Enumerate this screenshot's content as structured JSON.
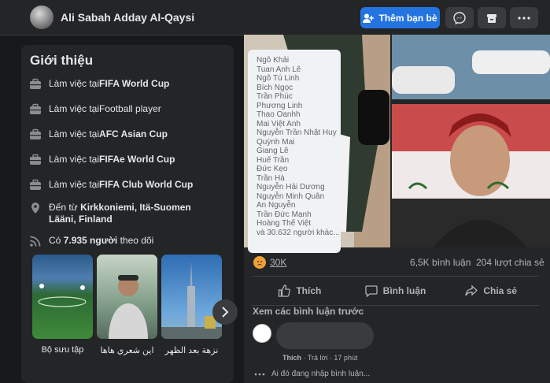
{
  "header": {
    "profile_name": "Ali Sabah Adday Al-Qaysi",
    "add_friend_label": "Thêm bạn bè",
    "accent_color": "#2374e1"
  },
  "intro": {
    "title": "Giới thiệu",
    "work": [
      {
        "prefix": "Làm việc tại ",
        "place": "FIFA World Cup"
      },
      {
        "prefix": "Làm việc tại ",
        "place": "Football player"
      },
      {
        "prefix": "Làm việc tại ",
        "place": "AFC Asian Cup"
      },
      {
        "prefix": "Làm việc tại ",
        "place": "FIFAe World Cup"
      },
      {
        "prefix": "Làm việc tại ",
        "place": "FIFA Club World Cup"
      }
    ],
    "from_prefix": "Đến từ ",
    "from_place": "Kirkkoniemi, Itä-Suomen Lääni, Finland",
    "followers_prefix": "Có ",
    "followers_count": "7.935 người",
    "followers_suffix": " theo dõi",
    "collections": [
      {
        "label": "Bộ sưu tập"
      },
      {
        "label": "اين شعري هاها"
      },
      {
        "label": "نزهة بعد الظهر"
      }
    ]
  },
  "post": {
    "reactors": [
      "Ngô Khải",
      "Tuan Anh Lê",
      "Ngô Tú Linh",
      "Bích Ngọc",
      "Trần Phúc",
      "Phương Linh",
      "Thao Oanhh",
      "Mai Việt Anh",
      "Nguyễn Trần Nhật Huy",
      "Quỳnh Mai",
      "Giang Lê",
      "Huế Trần",
      "Đức Kẹo",
      "Trần Hà",
      "Nguyễn Hải Dương",
      "Nguyễn Minh Quân",
      "An Nguyễn",
      "Trần Đức Mạnh",
      "Hoàng Thế Việt",
      "và 30.632 người khác..."
    ],
    "reaction_count": "30K",
    "comments_count": "6,5K bình luận",
    "shares_count": "204 lượt chia sẻ",
    "like_label": "Thích",
    "comment_label": "Bình luận",
    "share_label": "Chia sẻ",
    "previous_comments": "Xem các bình luận trước",
    "comment_like": "Thích",
    "comment_reply": "Trả lời",
    "comment_time": "17 phút",
    "typing_text": "Ai đó đang nhập bình luận..."
  }
}
